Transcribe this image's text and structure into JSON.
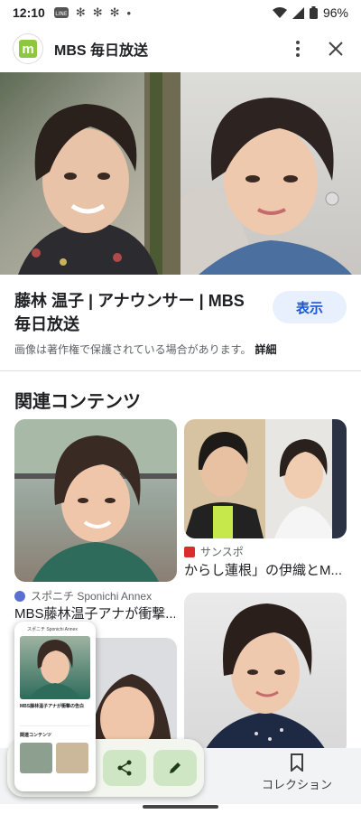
{
  "status_bar": {
    "time": "12:10",
    "battery": "96%"
  },
  "header": {
    "source_name": "MBS 毎日放送"
  },
  "result": {
    "title": "藤林 温子 | アナウンサー | MBS 毎日放送",
    "show_button": "表示",
    "copyright_notice": "画像は著作権で保護されている場合があります。",
    "details_link": "詳細"
  },
  "related": {
    "heading": "関連コンテンツ",
    "items": [
      {
        "source": "スポニチ Sponichi Annex",
        "caption": "MBS藤林温子アナが衝撃..."
      },
      {
        "source": "サンスポ",
        "caption": "からし蓮根」の伊織とM..."
      }
    ]
  },
  "bottom_bar": {
    "collection_label": "コレクション"
  },
  "thumbnail": {
    "source": "スポニチ Sponichi Annex",
    "title": "MBS藤林温子アナが衝撃の告白",
    "related_heading": "関連コンテンツ"
  },
  "colors": {
    "accent": "#1a57d6",
    "accent_bg": "#e8f0fe",
    "fab_bg": "#cfe6c4",
    "mbs_logo": "#8dc63f"
  }
}
